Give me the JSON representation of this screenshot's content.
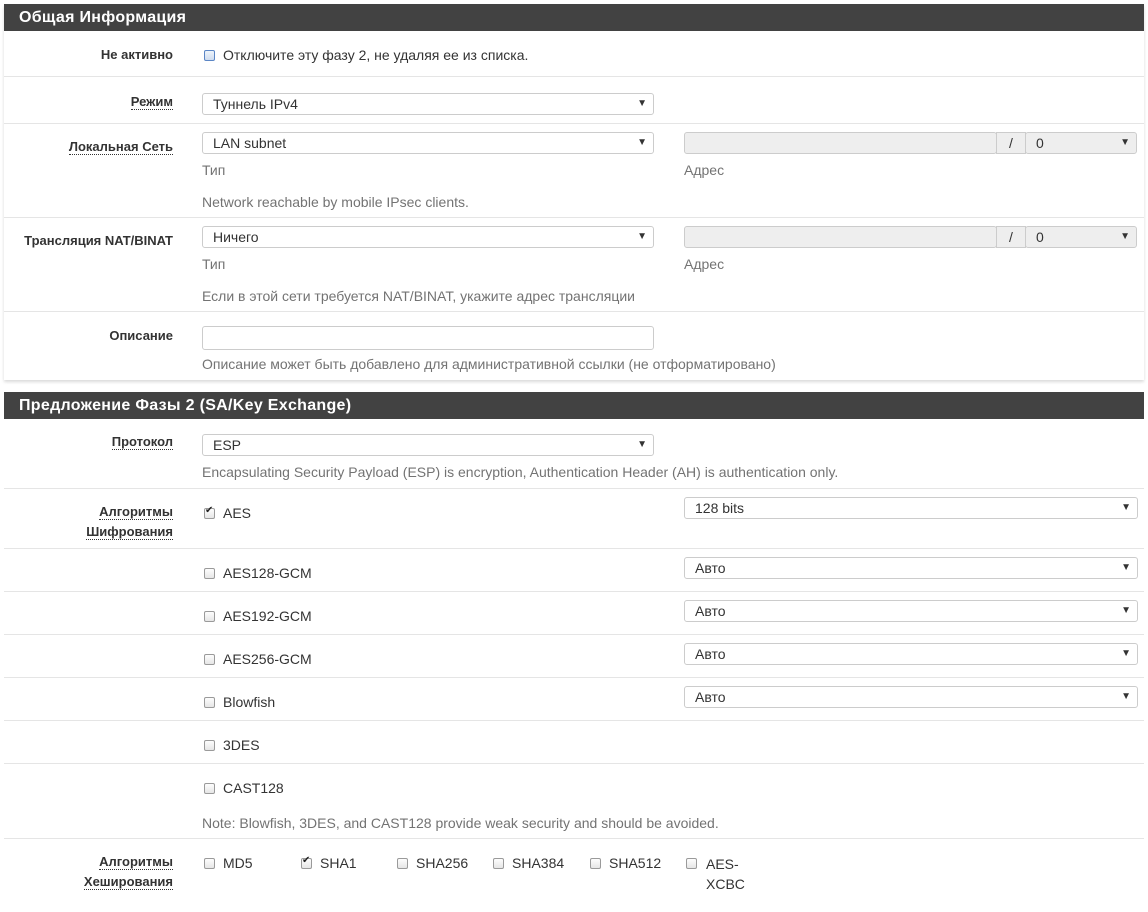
{
  "general": {
    "title": "Общая Информация",
    "disabled": {
      "label": "Не активно",
      "checkbox_text": "Отключите эту фазу 2, не удаляя ее из списка.",
      "checked": false
    },
    "mode": {
      "label": "Режим",
      "value": "Туннель IPv4"
    },
    "local_network": {
      "label": "Локальная Сеть",
      "type_value": "LAN subnet",
      "type_caption": "Тип",
      "address_value": "",
      "slash": "/",
      "mask_value": "0",
      "address_caption": "Адрес",
      "help": "Network reachable by mobile IPsec clients."
    },
    "nat": {
      "label": "Трансляция NAT/BINAT",
      "type_value": "Ничего",
      "type_caption": "Тип",
      "address_value": "",
      "slash": "/",
      "mask_value": "0",
      "address_caption": "Адрес",
      "help": "Если в этой сети требуется NAT/BINAT, укажите адрес трансляции"
    },
    "description": {
      "label": "Описание",
      "value": "",
      "help": "Описание может быть добавлено для административной ссылки (не отформатировано)"
    }
  },
  "proposal": {
    "title": "Предложение Фазы 2 (SA/Key Exchange)",
    "protocol": {
      "label": "Протокол",
      "value": "ESP",
      "help": "Encapsulating Security Payload (ESP) is encryption, Authentication Header (AH) is authentication only."
    },
    "encryption": {
      "label_line1": "Алгоритмы",
      "label_line2": "Шифрования",
      "algorithms": [
        {
          "name": "AES",
          "checked": true,
          "keylen": "128 bits"
        },
        {
          "name": "AES128-GCM",
          "checked": false,
          "keylen": "Авто"
        },
        {
          "name": "AES192-GCM",
          "checked": false,
          "keylen": "Авто"
        },
        {
          "name": "AES256-GCM",
          "checked": false,
          "keylen": "Авто"
        },
        {
          "name": "Blowfish",
          "checked": false,
          "keylen": "Авто"
        },
        {
          "name": "3DES",
          "checked": false
        },
        {
          "name": "CAST128",
          "checked": false
        }
      ],
      "note": "Note: Blowfish, 3DES, and CAST128 provide weak security and should be avoided."
    },
    "hashing": {
      "label_line1": "Алгоритмы",
      "label_line2": "Хеширования",
      "algorithms": [
        {
          "name": "MD5",
          "checked": false
        },
        {
          "name": "SHA1",
          "checked": true
        },
        {
          "name": "SHA256",
          "checked": false
        },
        {
          "name": "SHA384",
          "checked": false
        },
        {
          "name": "SHA512",
          "checked": false
        },
        {
          "name_line1": "AES-",
          "name_line2": "XCBC",
          "checked": false
        }
      ]
    }
  },
  "icons": {
    "dropdown": "chevron-down-icon",
    "check": "checkmark-icon"
  }
}
